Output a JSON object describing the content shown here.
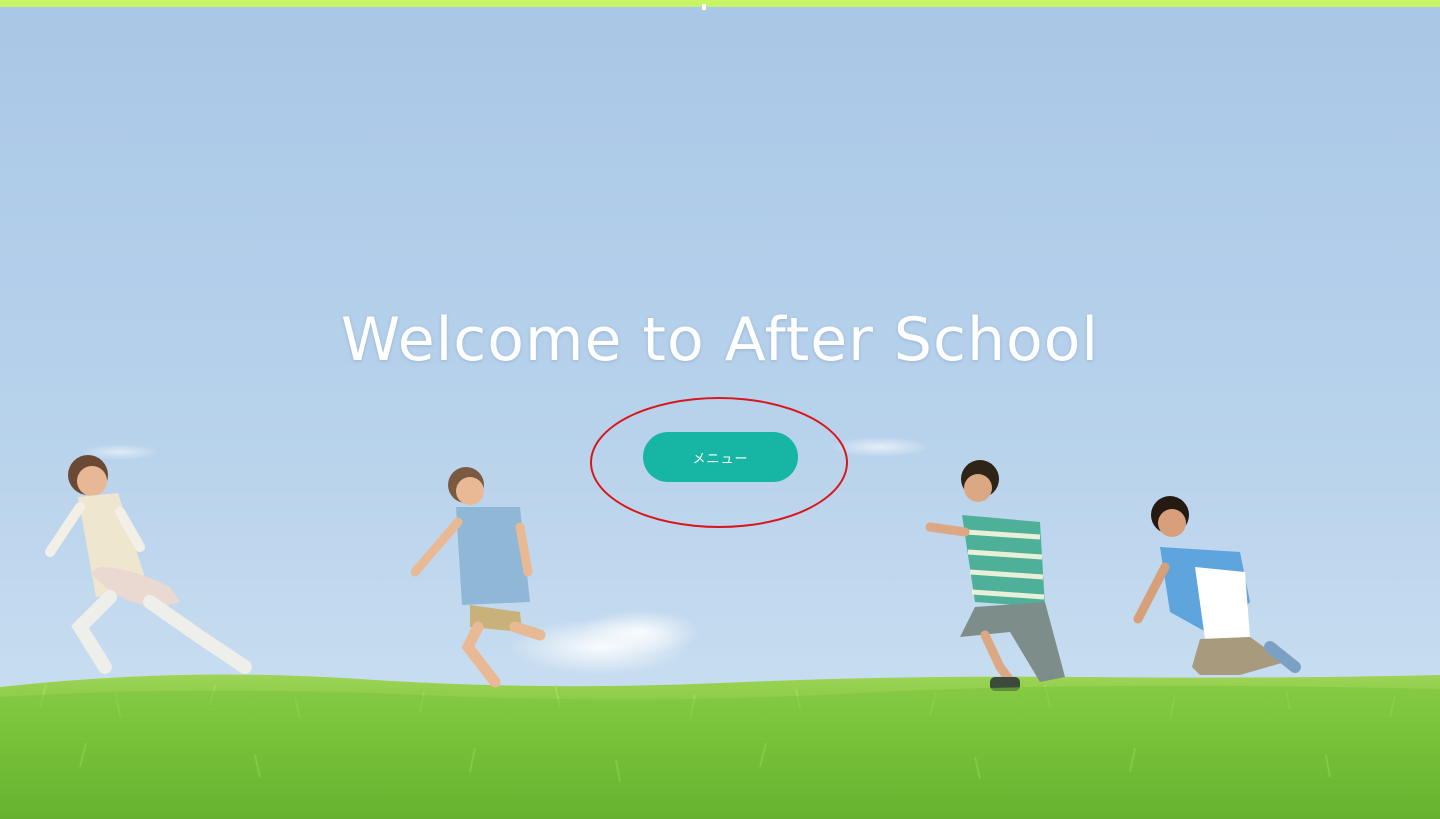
{
  "hero": {
    "title": "Welcome to After School",
    "menu_button_label": "メニュー"
  },
  "colors": {
    "top_bar": "#c8f566",
    "button_accent": "#16b5a4",
    "annotation": "#d8161b",
    "sky_top": "#aecbea",
    "sky_bottom": "#c7dcef",
    "grass": "#7cc43a"
  },
  "icons": {
    "hero_illustration": "children-running-on-grass-illustration"
  }
}
